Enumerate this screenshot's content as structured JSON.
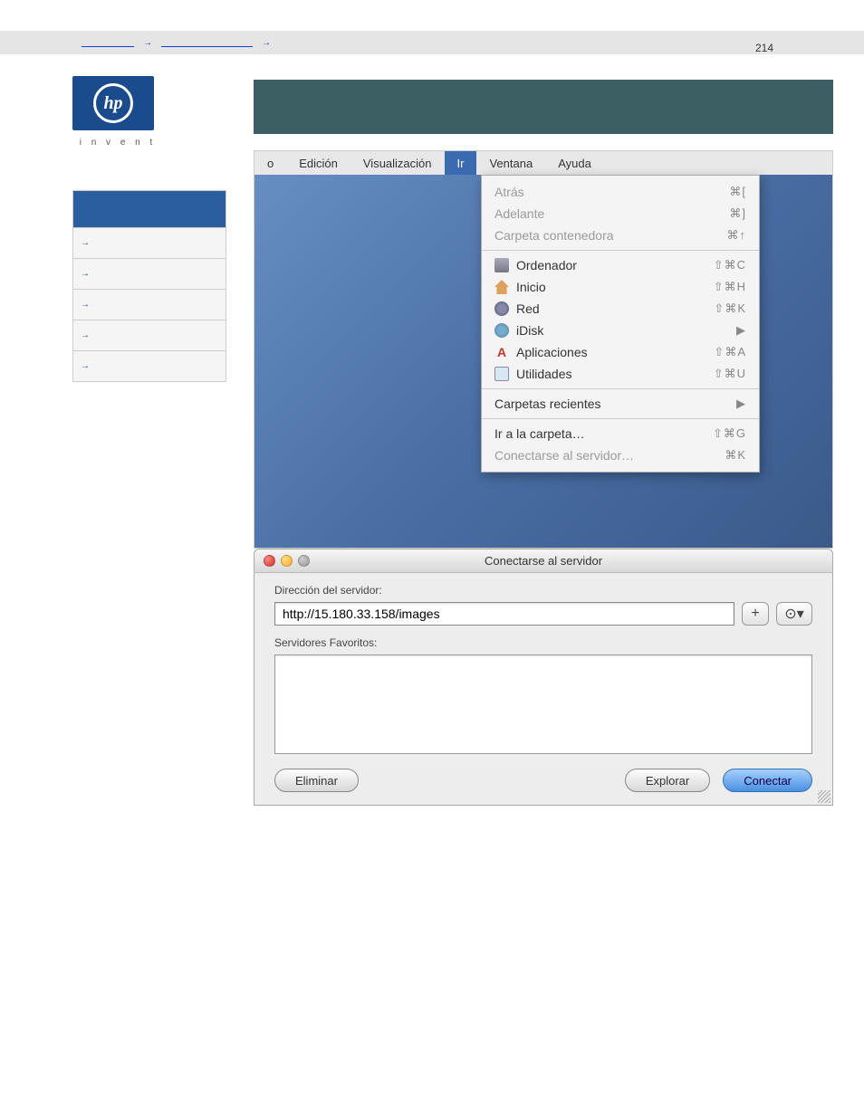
{
  "page_number": "214",
  "breadcrumb": {
    "sep": "→"
  },
  "hp_tagline": "i n v e n t",
  "hp_logo_text": "hp",
  "mac_menubar": {
    "partial": "o",
    "items": [
      "Edición",
      "Visualización",
      "Ir",
      "Ventana",
      "Ayuda"
    ],
    "selected_index": 2
  },
  "dropdown": {
    "atras": {
      "label": "Atrás",
      "shortcut": "⌘["
    },
    "adelante": {
      "label": "Adelante",
      "shortcut": "⌘]"
    },
    "contenedora": {
      "label": "Carpeta contenedora",
      "shortcut": "⌘↑"
    },
    "ordenador": {
      "label": "Ordenador",
      "shortcut": "⇧⌘C"
    },
    "inicio": {
      "label": "Inicio",
      "shortcut": "⇧⌘H"
    },
    "red": {
      "label": "Red",
      "shortcut": "⇧⌘K"
    },
    "idisk": {
      "label": "iDisk",
      "shortcut": "▶"
    },
    "aplicaciones": {
      "label": "Aplicaciones",
      "shortcut": "⇧⌘A"
    },
    "utilidades": {
      "label": "Utilidades",
      "shortcut": "⇧⌘U"
    },
    "recientes": {
      "label": "Carpetas recientes",
      "shortcut": "▶"
    },
    "ir_carpeta": {
      "label": "Ir a la carpeta…",
      "shortcut": "⇧⌘G"
    },
    "conectar": {
      "label": "Conectarse al servidor…",
      "shortcut": "⌘K"
    }
  },
  "connect_dialog": {
    "title": "Conectarse al servidor",
    "address_label": "Dirección del servidor:",
    "address_value": "http://15.180.33.158/images",
    "fav_label": "Servidores Favoritos:",
    "btn_add": "+",
    "btn_history": "⊙▾",
    "btn_remove": "Eliminar",
    "btn_browse": "Explorar",
    "btn_connect": "Conectar"
  }
}
